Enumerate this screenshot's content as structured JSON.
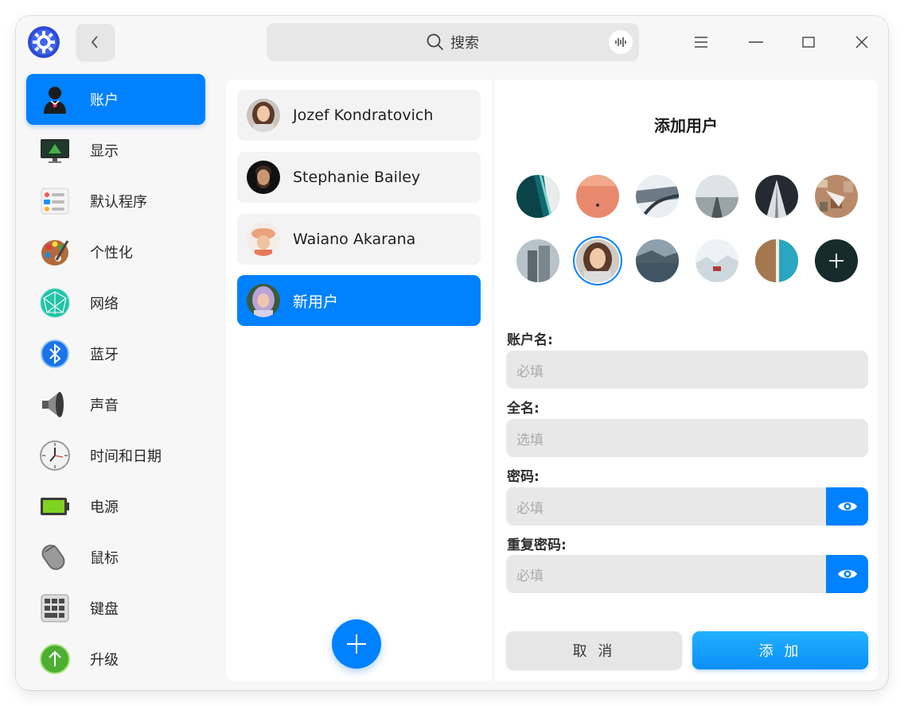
{
  "titlebar": {
    "search_label": "搜索",
    "icons": [
      "app-logo-icon",
      "chevron-left-icon",
      "search-icon",
      "voice-icon",
      "menu-icon",
      "minimize-icon",
      "maximize-icon",
      "close-icon"
    ]
  },
  "sidebar": {
    "items": [
      {
        "label": "账户",
        "icon": "account-icon",
        "active": true
      },
      {
        "label": "显示",
        "icon": "display-icon"
      },
      {
        "label": "默认程序",
        "icon": "default-apps-icon"
      },
      {
        "label": "个性化",
        "icon": "personalization-icon"
      },
      {
        "label": "网络",
        "icon": "network-icon"
      },
      {
        "label": "蓝牙",
        "icon": "bluetooth-icon"
      },
      {
        "label": "声音",
        "icon": "sound-icon"
      },
      {
        "label": "时间和日期",
        "icon": "clock-icon"
      },
      {
        "label": "电源",
        "icon": "battery-icon"
      },
      {
        "label": "鼠标",
        "icon": "mouse-icon"
      },
      {
        "label": "键盘",
        "icon": "keyboard-icon"
      },
      {
        "label": "升级",
        "icon": "update-icon"
      }
    ]
  },
  "users": {
    "items": [
      {
        "name": "Jozef Kondratovich"
      },
      {
        "name": "Stephanie Bailey"
      },
      {
        "name": "Waiano Akarana"
      },
      {
        "name": "新用户",
        "active": true
      }
    ],
    "add_icon": "plus-icon"
  },
  "form": {
    "title": "添加用户",
    "account_label": "账户名:",
    "account_placeholder": "必填",
    "fullname_label": "全名:",
    "fullname_placeholder": "选填",
    "password_label": "密码:",
    "password_placeholder": "必填",
    "repeat_label": "重复密码:",
    "repeat_placeholder": "必填",
    "cancel_label": "取 消",
    "add_label": "添 加"
  },
  "colors": {
    "accent": "#0081ff",
    "window_bg": "#f7f7f7",
    "panel_bg": "#ffffff",
    "field_bg": "#e8e8e8"
  }
}
